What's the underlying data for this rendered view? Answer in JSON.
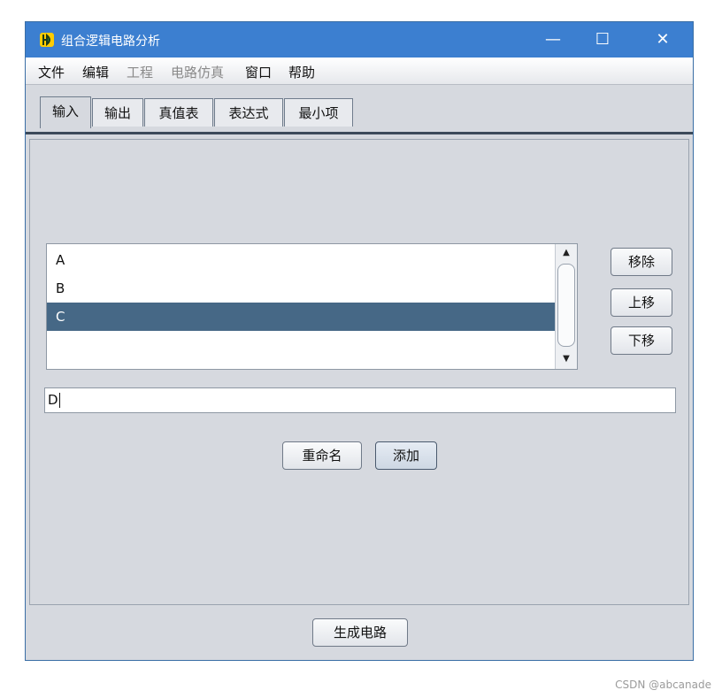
{
  "window": {
    "title": "组合逻辑电路分析",
    "controls": {
      "minimize": "—",
      "maximize": "☐",
      "close": "✕"
    }
  },
  "menu": [
    {
      "label": "文件",
      "enabled": true
    },
    {
      "label": "编辑",
      "enabled": true
    },
    {
      "label": "工程",
      "enabled": false
    },
    {
      "label": "电路仿真",
      "enabled": false
    },
    {
      "label": "窗口",
      "enabled": true
    },
    {
      "label": "帮助",
      "enabled": true
    }
  ],
  "tabs": [
    {
      "label": "输入",
      "active": true
    },
    {
      "label": "输出",
      "active": false
    },
    {
      "label": "真值表",
      "active": false
    },
    {
      "label": "表达式",
      "active": false
    },
    {
      "label": "最小项",
      "active": false
    }
  ],
  "input_list": {
    "items": [
      "A",
      "B",
      "C"
    ],
    "selected": "C"
  },
  "side_buttons": {
    "remove": "移除",
    "move_up": "上移",
    "move_down": "下移"
  },
  "name_field": {
    "value": "D"
  },
  "actions": {
    "rename": "重命名",
    "add": "添加"
  },
  "footer": {
    "generate": "生成电路"
  },
  "watermark": "CSDN @abcanade",
  "colors": {
    "titlebar": "#3c7fd0",
    "selection": "#466886",
    "background": "#d6d9df"
  }
}
